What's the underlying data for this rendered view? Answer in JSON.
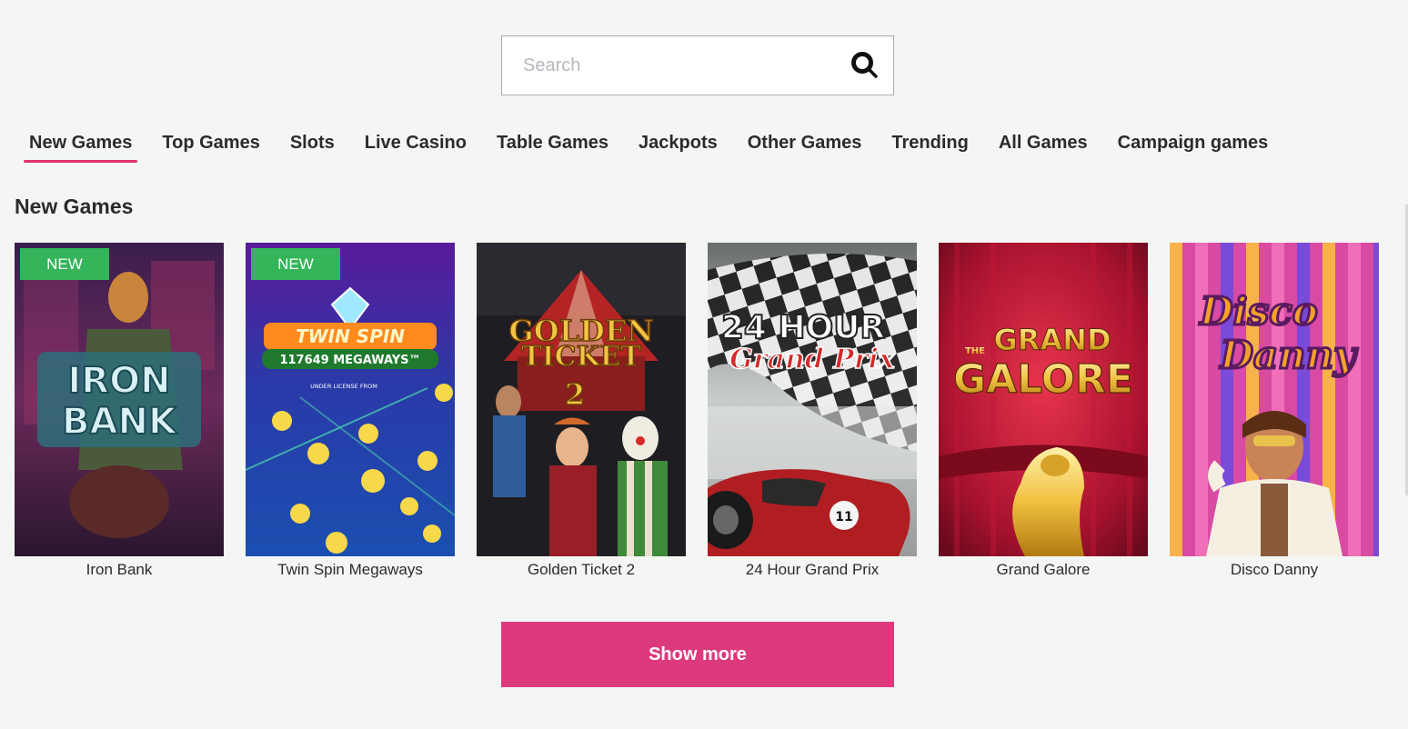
{
  "search": {
    "placeholder": "Search",
    "value": ""
  },
  "tabs": [
    {
      "label": "New Games",
      "active": true
    },
    {
      "label": "Top Games",
      "active": false
    },
    {
      "label": "Slots",
      "active": false
    },
    {
      "label": "Live Casino",
      "active": false
    },
    {
      "label": "Table Games",
      "active": false
    },
    {
      "label": "Jackpots",
      "active": false
    },
    {
      "label": "Other Games",
      "active": false
    },
    {
      "label": "Trending",
      "active": false
    },
    {
      "label": "All Games",
      "active": false
    },
    {
      "label": "Campaign games",
      "active": false
    }
  ],
  "section": {
    "title": "New Games"
  },
  "games": [
    {
      "name": "Iron Bank",
      "badge": "NEW",
      "art_title": [
        "IRON",
        "BANK"
      ]
    },
    {
      "name": "Twin Spin Megaways",
      "badge": "NEW",
      "art_title": [
        "TWIN SPIN",
        "117649 MEGAWAYS™",
        "UNDER LICENSE FROM"
      ]
    },
    {
      "name": "Golden Ticket 2",
      "badge": "",
      "art_title": [
        "GOLDEN",
        "TICKET",
        "2"
      ]
    },
    {
      "name": "24 Hour Grand Prix",
      "badge": "",
      "art_title": [
        "24 HOUR",
        "Grand Prix"
      ]
    },
    {
      "name": "Grand Galore",
      "badge": "",
      "art_title": [
        "THE",
        "GRAND",
        "GALORE"
      ]
    },
    {
      "name": "Disco Danny",
      "badge": "",
      "art_title": [
        "Disco",
        "Danny"
      ]
    }
  ],
  "actions": {
    "show_more_label": "Show more"
  },
  "colors": {
    "accent": "#e2306f",
    "button": "#dd3a7d",
    "badge": "#34b55a",
    "background": "#f4f6f4"
  }
}
